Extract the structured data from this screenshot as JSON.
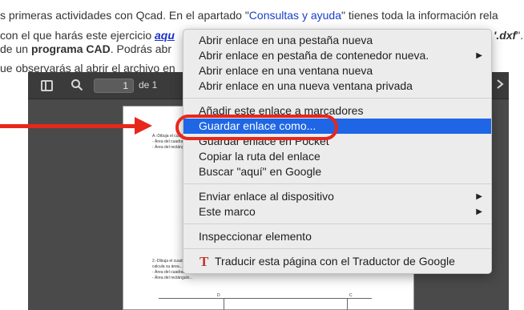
{
  "page": {
    "line1_a": "s primeras actividades con Qcad. En el apartado \"",
    "line1_link": "Consultas y ayuda",
    "line1_b": "\" tienes toda la información rela",
    "line2_a": "con el que harás este ejercicio ",
    "line2_link": "aqu",
    "line2_tail": "'.dxf",
    "line2_end": "\".",
    "line3_a": "de un ",
    "line3_bold": "programa CAD",
    "line3_b": ". Podrás abr",
    "line4": "ue observarás al abrir el archivo en"
  },
  "pdf_viewer": {
    "page_current": "1",
    "page_of": "de 1",
    "page_snippets": [
      "A.-Dibuja el cuadrado...",
      "- Área del cuadrado...",
      "- Área del rectángulo...",
      "2.-Dibuja el cuadrado...",
      "calcula su área...",
      "- Área del cuadrado...",
      "- Área del rectángulo..."
    ],
    "corner_labels": [
      "D",
      "C"
    ]
  },
  "context_menu": {
    "groups": [
      {
        "items": [
          {
            "label": "Abrir enlace en una pestaña nueva",
            "submenu": false
          },
          {
            "label": "Abrir enlace en pestaña de contenedor nueva.",
            "submenu": true
          },
          {
            "label": "Abrir enlace en una ventana nueva",
            "submenu": false
          },
          {
            "label": "Abrir enlace en una nueva ventana privada",
            "submenu": false
          }
        ]
      },
      {
        "items": [
          {
            "label": "Añadir este enlace a marcadores",
            "submenu": false
          },
          {
            "label": "Guardar enlace como...",
            "submenu": false,
            "highlighted": true
          },
          {
            "label": "Guardar enlace en Pocket",
            "submenu": false
          },
          {
            "label": "Copiar la ruta del enlace",
            "submenu": false
          },
          {
            "label": "Buscar \"aquí\" en Google",
            "submenu": false
          }
        ]
      },
      {
        "items": [
          {
            "label": "Enviar enlace al dispositivo",
            "submenu": true
          },
          {
            "label": "Este marco",
            "submenu": true
          }
        ]
      },
      {
        "items": [
          {
            "label": "Inspeccionar elemento",
            "submenu": false
          }
        ]
      },
      {
        "items": [
          {
            "label": "Traducir esta página con el Traductor de Google",
            "submenu": false,
            "icon": "translate-icon"
          }
        ]
      }
    ],
    "submenu_glyph": "▶",
    "translate_glyph": "T"
  },
  "colors": {
    "highlight": "#1e66e6",
    "annotation_red": "#e8271b",
    "link_blue": "#1a40c9"
  }
}
